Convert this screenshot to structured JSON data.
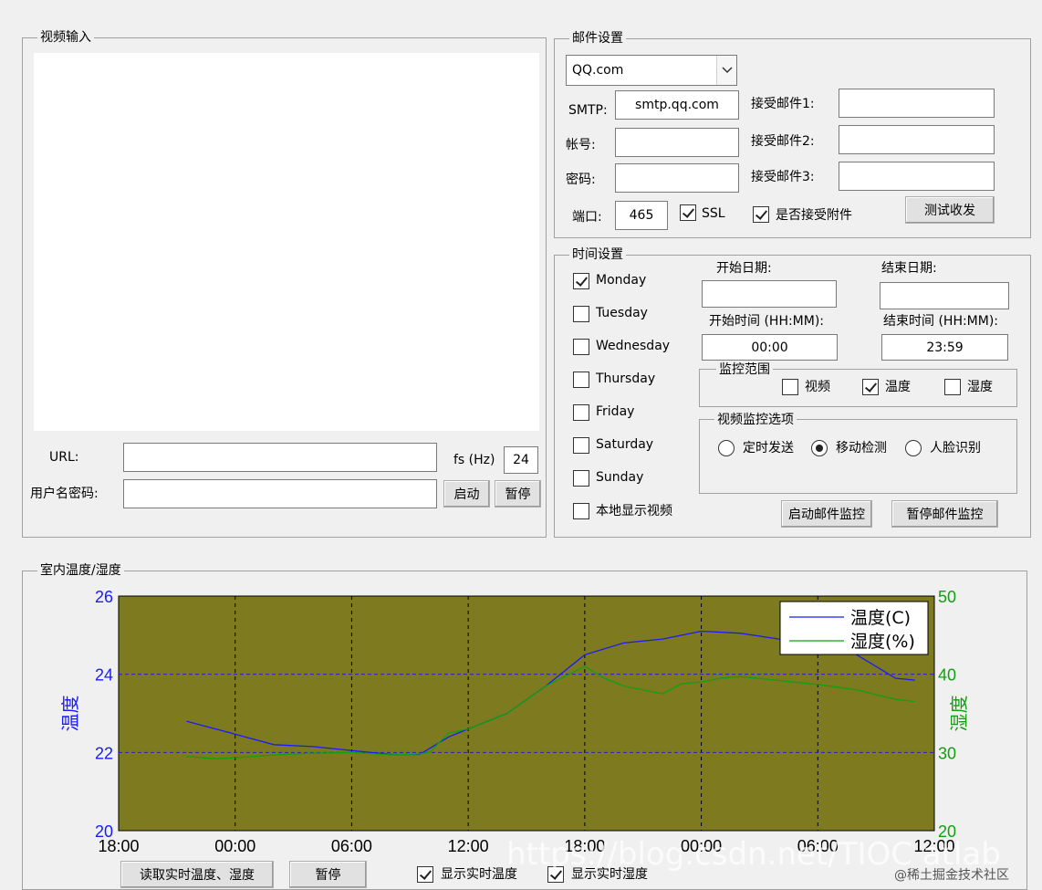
{
  "video": {
    "group_title": "视频输入",
    "url_label": "URL:",
    "url_value": "",
    "fs_label": "fs (Hz)",
    "fs_value": "24",
    "userpass_label": "用户名密码:",
    "userpass_value": "",
    "start_btn": "启动",
    "pause_btn": "暂停"
  },
  "mail": {
    "group_title": "邮件设置",
    "provider": "QQ.com",
    "smtp_label": "SMTP:",
    "smtp_value": "smtp.qq.com",
    "account_label": "帐号:",
    "account_value": "",
    "password_label": "密码:",
    "password_value": "",
    "port_label": "端口:",
    "port_value": "465",
    "ssl_label": "SSL",
    "ssl_checked": true,
    "attach_label": "是否接受附件",
    "attach_checked": true,
    "recv1_label": "接受邮件1:",
    "recv2_label": "接受邮件2:",
    "recv3_label": "接受邮件3:",
    "recv1_value": "",
    "recv2_value": "",
    "recv3_value": "",
    "test_btn": "测试收发"
  },
  "time": {
    "group_title": "时间设置",
    "days": [
      {
        "label": "Monday",
        "checked": true
      },
      {
        "label": "Tuesday",
        "checked": false
      },
      {
        "label": "Wednesday",
        "checked": false
      },
      {
        "label": "Thursday",
        "checked": false
      },
      {
        "label": "Friday",
        "checked": false
      },
      {
        "label": "Saturday",
        "checked": false
      },
      {
        "label": "Sunday",
        "checked": false
      }
    ],
    "local_video_label": "本地显示视频",
    "local_video_checked": false,
    "start_date_label": "开始日期:",
    "end_date_label": "结束日期:",
    "start_date_value": "",
    "end_date_value": "",
    "start_time_label": "开始时间 (HH:MM):",
    "end_time_label": "结束时间 (HH:MM):",
    "start_time_value": "00:00",
    "end_time_value": "23:59",
    "monitor_range": {
      "title": "监控范围",
      "items": [
        {
          "label": "视频",
          "checked": false
        },
        {
          "label": "温度",
          "checked": true
        },
        {
          "label": "湿度",
          "checked": false
        }
      ]
    },
    "video_options": {
      "title": "视频监控选项",
      "items": [
        {
          "label": "定时发送",
          "selected": false
        },
        {
          "label": "移动检测",
          "selected": true
        },
        {
          "label": "人脸识别",
          "selected": false
        }
      ]
    },
    "start_mail_btn": "启动邮件监控",
    "pause_mail_btn": "暂停邮件监控"
  },
  "env": {
    "group_title": "室内温度/湿度",
    "read_btn": "读取实时温度、湿度",
    "pause_btn": "暂停",
    "show_temp_label": "显示实时温度",
    "show_humid_label": "显示实时湿度",
    "show_temp_checked": true,
    "show_humid_checked": true
  },
  "watermark": {
    "main": "https://blog.csdn.net/TIOC  atlab",
    "corner": "@稀土掘金技术社区"
  },
  "chart_data": {
    "type": "line",
    "title": "",
    "xlabel": "",
    "ylabel_left": "温度",
    "ylabel_right": "湿度",
    "x_ticks": [
      "18:00",
      "00:00",
      "06:00",
      "12:00",
      "18:00",
      "00:00",
      "06:00",
      "12:00"
    ],
    "x_range_hours": [
      0,
      42
    ],
    "ylim_left": [
      20,
      26
    ],
    "yticks_left": [
      "20",
      "22",
      "24",
      "26"
    ],
    "ylim_right": [
      20,
      50
    ],
    "yticks_right": [
      "20",
      "30",
      "40",
      "50"
    ],
    "grid": true,
    "legend_position": "top-right",
    "background_color": "#7d7a1f",
    "colors": {
      "temperature": "#1a1aff",
      "humidity": "#11a011"
    },
    "series": [
      {
        "name": "温度(C)",
        "axis": "left",
        "x": [
          3.5,
          5,
          6.5,
          8,
          10,
          12,
          14,
          15.5,
          17,
          18,
          20,
          22,
          24,
          26,
          28,
          30,
          32,
          34,
          35,
          36,
          37,
          38,
          39,
          40,
          41
        ],
        "values": [
          22.8,
          22.6,
          22.4,
          22.2,
          22.15,
          22.05,
          21.95,
          21.95,
          22.4,
          22.6,
          23.0,
          23.7,
          24.5,
          24.8,
          24.9,
          25.1,
          25.05,
          24.9,
          24.85,
          24.8,
          24.7,
          24.5,
          24.2,
          23.9,
          23.85
        ]
      },
      {
        "name": "湿度(%)",
        "axis": "right",
        "x": [
          3.5,
          5,
          6.5,
          8,
          10,
          12,
          14,
          15.5,
          16,
          17,
          18,
          20,
          22,
          24,
          25,
          26,
          27,
          28,
          29,
          30,
          31,
          32,
          34,
          36,
          38,
          40,
          41
        ],
        "values": [
          29.5,
          29.2,
          29.4,
          29.7,
          29.9,
          30.0,
          29.7,
          29.8,
          30.0,
          32.5,
          33.0,
          35.0,
          38.5,
          41.0,
          39.5,
          38.5,
          38.0,
          37.5,
          38.8,
          39.0,
          39.5,
          39.7,
          39.2,
          38.7,
          38.0,
          36.8,
          36.5
        ]
      }
    ]
  }
}
